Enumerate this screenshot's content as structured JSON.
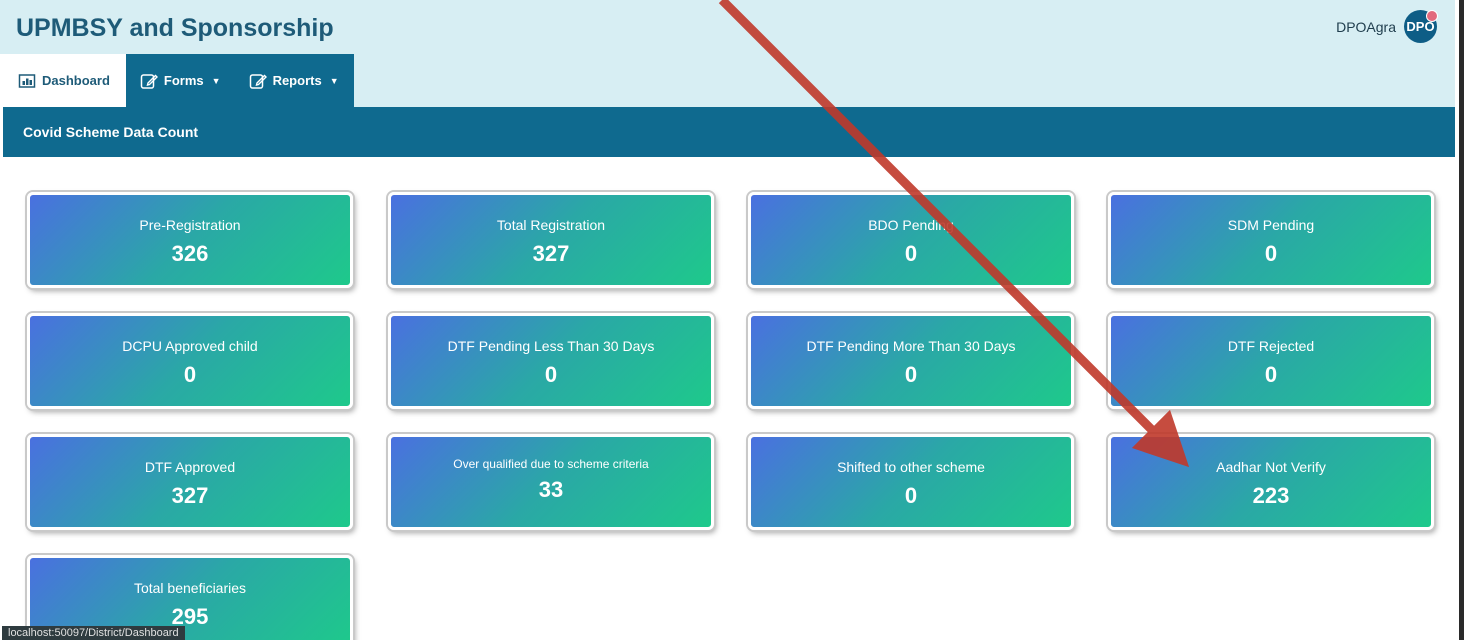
{
  "header": {
    "title": "UPMBSY and Sponsorship",
    "user_name": "DPOAgra",
    "avatar_text": "DPO"
  },
  "nav": {
    "tabs": [
      {
        "label": "Dashboard",
        "icon": "dashboard-icon",
        "active": true
      },
      {
        "label": "Forms",
        "icon": "edit-icon",
        "has_dropdown": true
      },
      {
        "label": "Reports",
        "icon": "edit-icon",
        "has_dropdown": true
      }
    ]
  },
  "section": {
    "title": "Covid Scheme Data Count"
  },
  "cards": [
    {
      "label": "Pre-Registration",
      "value": "326"
    },
    {
      "label": "Total Registration",
      "value": "327"
    },
    {
      "label": "BDO Pending",
      "value": "0"
    },
    {
      "label": "SDM Pending",
      "value": "0"
    },
    {
      "label": "DCPU Approved child",
      "value": "0"
    },
    {
      "label": "DTF Pending Less Than 30 Days",
      "value": "0"
    },
    {
      "label": "DTF Pending More Than 30 Days",
      "value": "0"
    },
    {
      "label": "DTF Rejected",
      "value": "0"
    },
    {
      "label": "DTF Approved",
      "value": "327"
    },
    {
      "label": "Over qualified due to scheme criteria",
      "value": "33"
    },
    {
      "label": "Shifted to other scheme",
      "value": "0"
    },
    {
      "label": "Aadhar Not Verify",
      "value": "223"
    },
    {
      "label": "Total beneficiaries",
      "value": "295"
    }
  ],
  "status_bar": {
    "text": "localhost:50097/District/Dashboard"
  },
  "colors": {
    "header_bg": "#d7eef3",
    "nav_bg": "#0f6a8f",
    "title": "#1e5b78",
    "card_gradient_start": "#4a70e0",
    "card_gradient_end": "#1ec98b",
    "annotation_arrow": "#c0392b"
  }
}
